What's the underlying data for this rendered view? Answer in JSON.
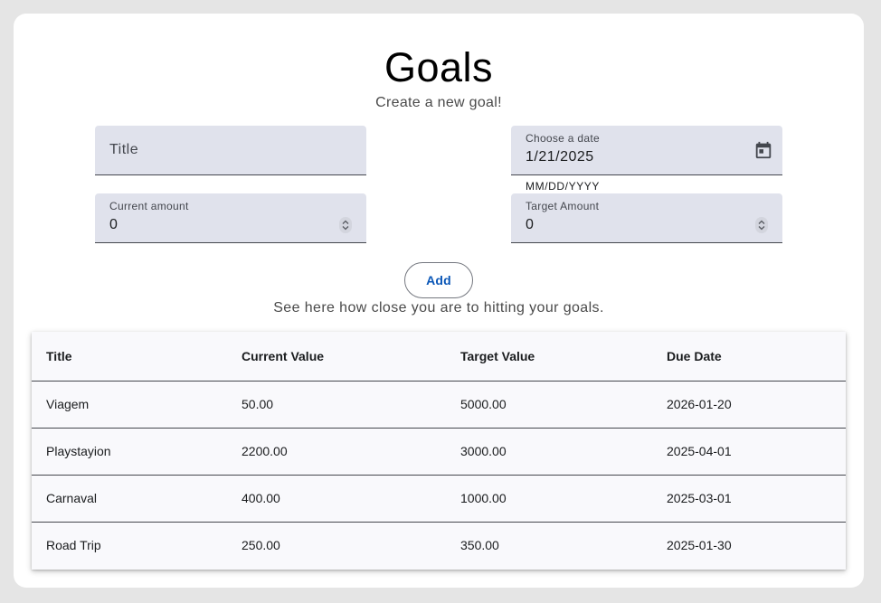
{
  "header": {
    "title": "Goals",
    "subtitle": "Create a new goal!"
  },
  "form": {
    "title_field": {
      "placeholder": "Title",
      "value": ""
    },
    "date_field": {
      "label": "Choose a date",
      "value": "1/21/2025",
      "hint": "MM/DD/YYYY",
      "icon": "calendar-icon"
    },
    "current_amount": {
      "label": "Current amount",
      "value": "0"
    },
    "target_amount": {
      "label": "Target Amount",
      "value": "0"
    },
    "add_label": "Add"
  },
  "table_caption": "See here how close you are to hitting your goals.",
  "table": {
    "columns": [
      "Title",
      "Current Value",
      "Target Value",
      "Due Date"
    ],
    "rows": [
      [
        "Viagem",
        "50.00",
        "5000.00",
        "2026-01-20"
      ],
      [
        "Playstayion",
        "2200.00",
        "3000.00",
        "2025-04-01"
      ],
      [
        "Carnaval",
        "400.00",
        "1000.00",
        "2025-03-01"
      ],
      [
        "Road Trip",
        "250.00",
        "350.00",
        "2025-01-30"
      ]
    ]
  },
  "colors": {
    "background": "#e5e5e5",
    "field_fill": "#e0e2ec",
    "accent": "#0b57b7",
    "table_bg": "#f9f9fc"
  }
}
